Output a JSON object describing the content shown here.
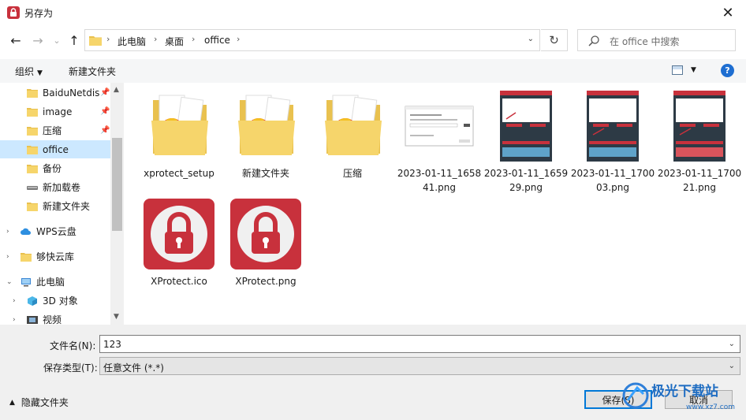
{
  "window": {
    "title": "另存为",
    "close_glyph": "✕"
  },
  "nav": {
    "back_glyph": "←",
    "forward_glyph": "→",
    "recent_glyph": "⌄",
    "up_glyph": "↑",
    "breadcrumb": [
      "此电脑",
      "桌面",
      "office"
    ],
    "refresh_glyph": "↻",
    "search_placeholder": "在 office 中搜索"
  },
  "toolbar": {
    "organize": "组织",
    "new_folder": "新建文件夹",
    "help": "?"
  },
  "sidebar": {
    "items": [
      {
        "label": "BaiduNetdis",
        "icon": "folder-icon",
        "pinned": true
      },
      {
        "label": "image",
        "icon": "folder-icon",
        "pinned": true
      },
      {
        "label": "压缩",
        "icon": "folder-icon",
        "pinned": true
      },
      {
        "label": "office",
        "icon": "folder-icon",
        "selected": true
      },
      {
        "label": "备份",
        "icon": "folder-icon"
      },
      {
        "label": "新加载卷",
        "icon": "drive-icon"
      },
      {
        "label": "新建文件夹",
        "icon": "folder-icon"
      },
      {
        "label": "WPS云盘",
        "icon": "cloud-icon"
      },
      {
        "label": "够快云库",
        "icon": "folder-icon"
      },
      {
        "label": "此电脑",
        "icon": "computer-icon"
      },
      {
        "label": "3D 对象",
        "icon": "3d-objects-icon"
      },
      {
        "label": "视频",
        "icon": "video-icon"
      }
    ]
  },
  "files": [
    {
      "name": "xprotect_setup",
      "type": "folder"
    },
    {
      "name": "新建文件夹",
      "type": "folder"
    },
    {
      "name": "压缩",
      "type": "folder"
    },
    {
      "name": "2023-01-11_165841.png",
      "type": "image-dialog"
    },
    {
      "name": "2023-01-11_165929.png",
      "type": "image-app"
    },
    {
      "name": "2023-01-11_170003.png",
      "type": "image-app"
    },
    {
      "name": "2023-01-11_170021.png",
      "type": "image-app"
    },
    {
      "name": "XProtect.ico",
      "type": "lock-icon"
    },
    {
      "name": "XProtect.png",
      "type": "lock-icon"
    }
  ],
  "form": {
    "filename_label": "文件名(N):",
    "filename_value": "123",
    "filetype_label": "保存类型(T):",
    "filetype_value": "任意文件 (*.*)",
    "hide_folders": "隐藏文件夹",
    "save": "保存(S)",
    "cancel": "取消"
  },
  "watermark": {
    "text": "极光下载站",
    "url": "www.xz7.com"
  },
  "colors": {
    "accent": "#0078d7",
    "selected": "#cce8ff",
    "brand_red": "#c8313c",
    "folder": "#f6d56b"
  }
}
